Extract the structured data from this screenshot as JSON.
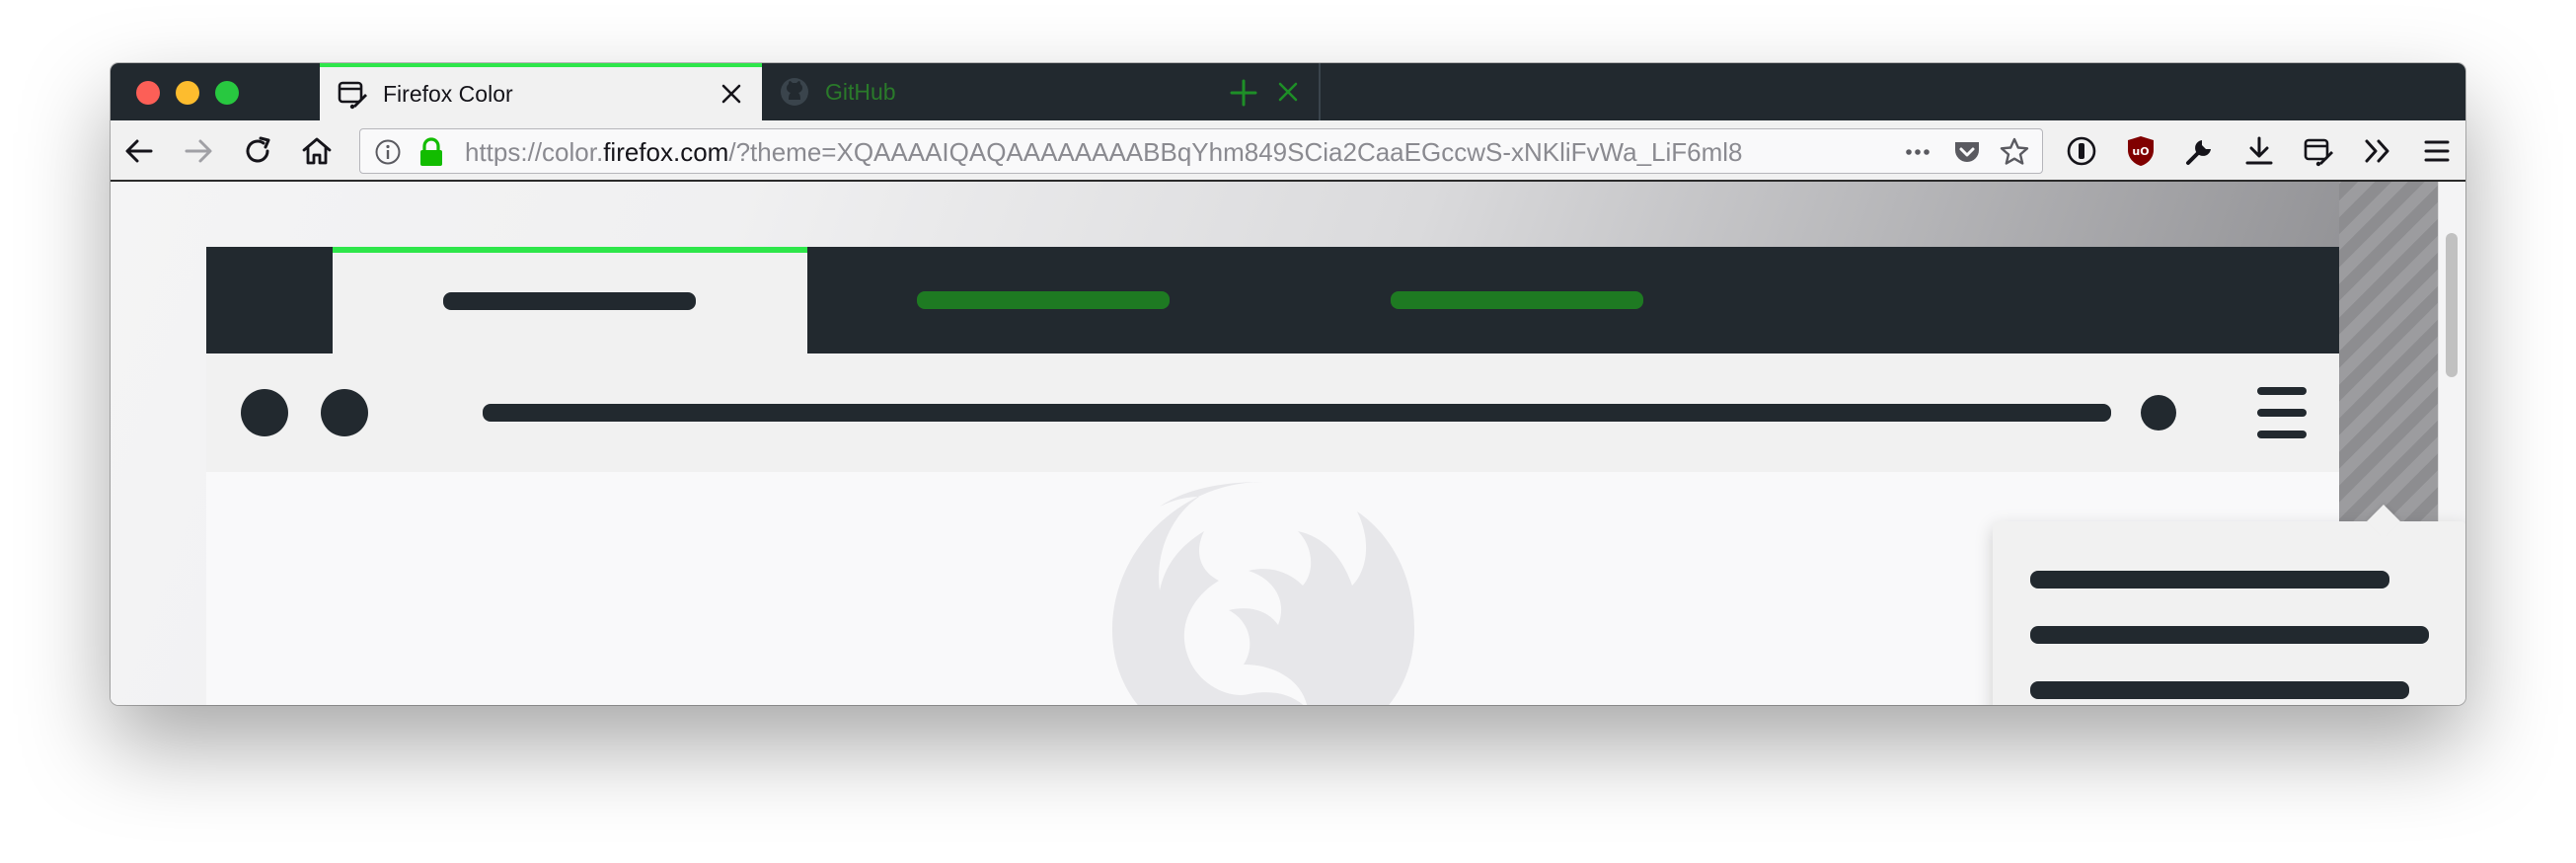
{
  "window": {
    "traffic_lights": [
      "close",
      "minimize",
      "zoom"
    ],
    "colors": {
      "close": "#fc5f57",
      "minimize": "#fdbc2e",
      "zoom": "#28c840"
    }
  },
  "tabs": [
    {
      "title": "Firefox Color",
      "active": true,
      "favicon": "firefox-color-icon"
    },
    {
      "title": "GitHub",
      "active": false,
      "favicon": "github-icon"
    }
  ],
  "toolbar": {
    "url": {
      "scheme": "https://color.",
      "host": "firefox.com",
      "rest": "/?theme=XQAAAAIQAQAAAAAAAABBqYhm849SCia2CaaEGccwS-xNKliFvWa_LiF6ml8"
    },
    "url_icons": [
      "info-icon",
      "lock-icon"
    ],
    "urlbar_actions": [
      "page-actions-icon",
      "pocket-icon",
      "bookmark-star-icon"
    ],
    "extensions": [
      "1password-icon",
      "ublock-origin-icon",
      "wrench-icon",
      "download-icon",
      "firefox-color-icon",
      "overflow-chevron-icon",
      "hamburger-menu-icon"
    ]
  },
  "theme_colors": {
    "frame": "#22292f",
    "tab_selected": "#f1f1f1",
    "tab_line": "#2ee64a",
    "tab_text": "#1e7a22",
    "toolbar": "#f1f1f1"
  }
}
